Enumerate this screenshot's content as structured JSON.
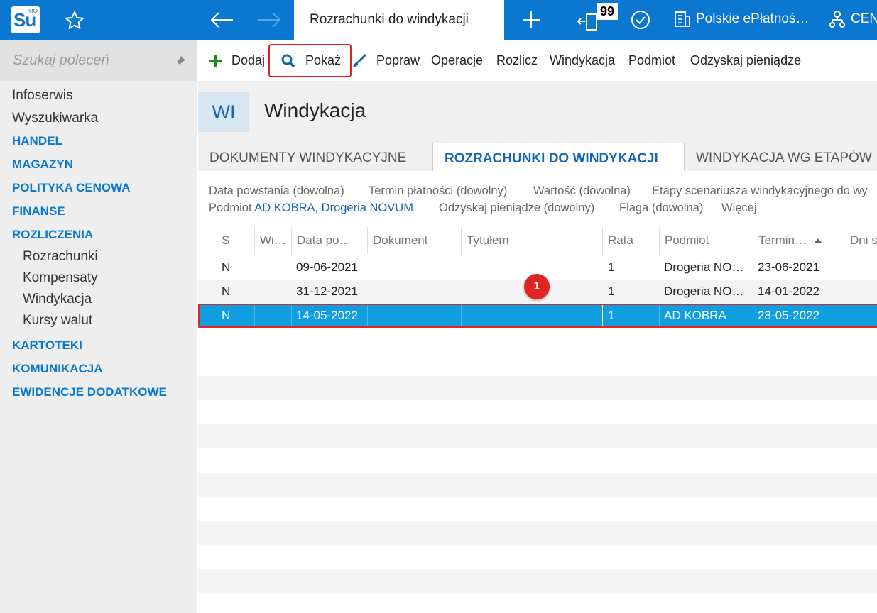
{
  "app": {
    "logo_text": "Su",
    "logo_sup": "PRO",
    "active_tab_title": "Rozrachunki do windykacji",
    "open_windows_count": "99",
    "bank_label": "Polskie ePłatnoś…",
    "center_label": "CEN"
  },
  "sidebar": {
    "search_placeholder": "Szukaj poleceń",
    "items": [
      {
        "label": "Infoserwis",
        "kind": "plain"
      },
      {
        "label": "Wyszukiwarka",
        "kind": "plain"
      },
      {
        "label": "HANDEL",
        "kind": "section"
      },
      {
        "label": "MAGAZYN",
        "kind": "section"
      },
      {
        "label": "POLITYKA CENOWA",
        "kind": "section"
      },
      {
        "label": "FINANSE",
        "kind": "section"
      },
      {
        "label": "ROZLICZENIA",
        "kind": "section"
      },
      {
        "label": "Rozrachunki",
        "kind": "sub"
      },
      {
        "label": "Kompensaty",
        "kind": "sub"
      },
      {
        "label": "Windykacja",
        "kind": "sub"
      },
      {
        "label": "Kursy walut",
        "kind": "sub"
      },
      {
        "label": "KARTOTEKI",
        "kind": "section"
      },
      {
        "label": "KOMUNIKACJA",
        "kind": "section"
      },
      {
        "label": "EWIDENCJE DODATKOWE",
        "kind": "section"
      }
    ]
  },
  "toolbar": {
    "add": "Dodaj",
    "show": "Pokaż",
    "edit": "Popraw",
    "operations": "Operacje",
    "settle": "Rozlicz",
    "collection": "Windykacja",
    "entity": "Podmiot",
    "recover": "Odzyskaj pieniądze"
  },
  "module": {
    "badge": "WI",
    "title": "Windykacja"
  },
  "tabs": [
    {
      "label": "DOKUMENTY WINDYKACYJNE",
      "active": false
    },
    {
      "label": "ROZRACHUNKI DO WINDYKACJI",
      "active": true
    },
    {
      "label": "WINDYKACJA WG ETAPÓW",
      "active": false
    }
  ],
  "filters": {
    "date_created": "Data powstania (dowolna)",
    "due_date": "Termin płatności (dowolny)",
    "value": "Wartość (dowolna)",
    "stages": "Etapy scenariusza windykacyjnego do wy",
    "entity_prefix": "Podmiot",
    "entity_value": "AD KOBRA, Drogeria NOVUM",
    "recover": "Odzyskaj pieniądze (dowolny)",
    "flag": "Flaga (dowolna)",
    "more": "Więcej"
  },
  "grid": {
    "columns": [
      "S",
      "Wi…",
      "Data po…",
      "Dokument",
      "Tytułem",
      "Rata",
      "Podmiot",
      "Termin…",
      "Dni s"
    ],
    "sort_column": "Termin…",
    "sort_direction": "ascending",
    "rows": [
      {
        "s": "N",
        "wi": "",
        "date": "09-06-2021",
        "doc": "",
        "title": "",
        "rata": "1",
        "entity": "Drogeria NO…",
        "due": "23-06-2021",
        "days": ""
      },
      {
        "s": "N",
        "wi": "",
        "date": "31-12-2021",
        "doc": "",
        "title": "",
        "rata": "1",
        "entity": "Drogeria NO…",
        "due": "14-01-2022",
        "days": ""
      },
      {
        "s": "N",
        "wi": "",
        "date": "14-05-2022",
        "doc": "",
        "title": "",
        "rata": "1",
        "entity": "AD KOBRA",
        "due": "28-05-2022",
        "days": "",
        "selected": true
      }
    ],
    "selected_row_color": "#0f9ee0"
  },
  "annotation": {
    "step": "1",
    "color": "#e02424"
  },
  "colors": {
    "brand": "#0a78d0",
    "section_text": "#0a78d0",
    "link": "#1565b4"
  }
}
